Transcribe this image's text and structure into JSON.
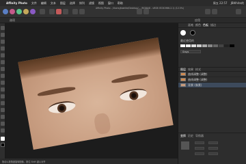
{
  "menubar": {
    "apple_glyph": "",
    "app_name": "Affinity Photo",
    "items": [
      "文件",
      "编辑",
      "文本",
      "图层",
      "选择",
      "排列",
      "滤镜",
      "视图",
      "窗口",
      "帮助"
    ],
    "clock": "周五 22:57",
    "user": "JBWhite的"
  },
  "toolbar": {
    "title": "Affinity Photo - /Users/jbwhite/Desktop/... (RGBA/8 - sRGB IEC61966-2.1) (12.5%)"
  },
  "contextbar": {
    "label": "选项",
    "apply": "应用"
  },
  "panel": {
    "tabs": [
      "画笔",
      "颜色",
      "色板",
      "描边"
    ],
    "section_label": "最近使用的",
    "chip_label": "Grays",
    "layers_tabs": [
      "图层",
      "效果",
      "样式"
    ],
    "layers": [
      {
        "name": "曲线调整 (调整)"
      },
      {
        "name": "曲线调整 (调整)"
      },
      {
        "name": "背景 (像素)"
      }
    ],
    "adj_tabs": [
      "变换",
      "历史",
      "导航器"
    ]
  },
  "status": {
    "text": "拖动以按角度旋转图像，按住 Shift 键以对齐"
  },
  "colors": {
    "accent": "#3d4a5c"
  }
}
